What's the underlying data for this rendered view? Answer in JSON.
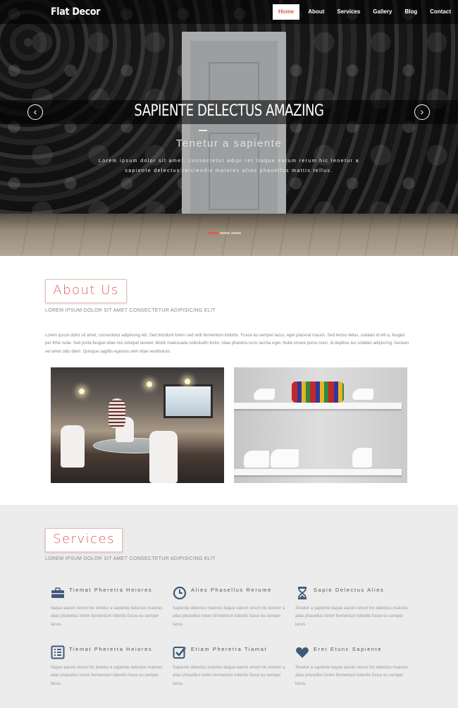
{
  "brand": "Flat Decor",
  "nav": {
    "items": [
      {
        "label": "Home",
        "active": true
      },
      {
        "label": "About",
        "active": false
      },
      {
        "label": "Services",
        "active": false
      },
      {
        "label": "Gallery",
        "active": false
      },
      {
        "label": "Blog",
        "active": false
      },
      {
        "label": "Contact",
        "active": false
      }
    ]
  },
  "slider": {
    "title": "SAPIENTE DELECTUS AMAZING",
    "subtitle": "Tenetur a sapiente",
    "text": "Lorem ipsum dolor sit amet, consectetur adipi ret Itaque earum rerum hic tenetur a sapiente delectus reiciendis maiores alias phasellus mattis tellus.",
    "prev_icon": "chevron-left-icon",
    "next_icon": "chevron-right-icon",
    "active_slide": 1,
    "slide_count": 3
  },
  "about": {
    "heading": "About Us",
    "subheading": "LOREM IPSUM DOLOR SIT AMET CONSECTETUR ADIPISICING ELIT",
    "body": "Lorem ipsum dolor sit amet, consectetur adipiscing elit. Sed tincidunt lorem sed velit fermentum lobortis. Fusce eu semper lacus, eget placerat mauris. Sed lectus tellus, sodales id elit a, feugiat per thhe nulla. Sed porta feugiat vitae nisi volutpat laoreet. Morbi malesuada sollicitudin tortor, vitae pharetra nunc lacinia eget. Nulla ornare purus nunc, id dapibus leo sodales adipiscing. Aenean vel amet odio diam. Quisque sagittis egestas sem vitae vestibulum.",
    "images": [
      "living-room-photo",
      "shoe-shelves-photo"
    ]
  },
  "services": {
    "heading": "Services",
    "subheading": "LOREM IPSUM DOLOR SIT AMET CONSECTETUR ADIPISICING ELIT",
    "items": [
      {
        "icon": "briefcase-icon",
        "title": "Tiemat Pheretra Heiores",
        "desc": "Itaque earum rerum hic tenetur a sapiente delectus maiores alias phasellus lorem fermentum lobortis fusce eu semper lacus."
      },
      {
        "icon": "clock-icon",
        "title": "Alies Phasellus Rerume",
        "desc": "Sapiente delectus maiores itaque earum rerum hic tenetur a alias phasellus lorem fermentum lobortis fusce eu semper lacus."
      },
      {
        "icon": "hourglass-icon",
        "title": "Sapie Delectus Alies",
        "desc": "Tenetur a sapiente itaque earum rerum hic delectus maiores alias phasellus lorem fermentum lobortis fusce eu semper lacus."
      },
      {
        "icon": "list-icon",
        "title": "Tiemat Pheretra Heiores",
        "desc": "Itaque earum rerum hic tenetur a sapiente delectus maiores alias phasellus lorem fermentum lobortis fusce eu semper lacus."
      },
      {
        "icon": "checkbox-icon",
        "title": "Etiam Pheretra Tiamat",
        "desc": "Sapiente delectus maiores itaque earum rerum hic tenetur a alias phasellus lorem fermentum lobortis fusce eu semper lacus."
      },
      {
        "icon": "heart-icon",
        "title": "Eret Etunc Sapiente",
        "desc": "Tenetur a sapiente itaque earum rerum hic delectus maiores alias phasellus lorem fermentum lobortis fusce eu semper lacus."
      }
    ]
  },
  "colors": {
    "accent": "#e05a50",
    "icon": "#3e5a78",
    "services_bg": "#ececec"
  }
}
